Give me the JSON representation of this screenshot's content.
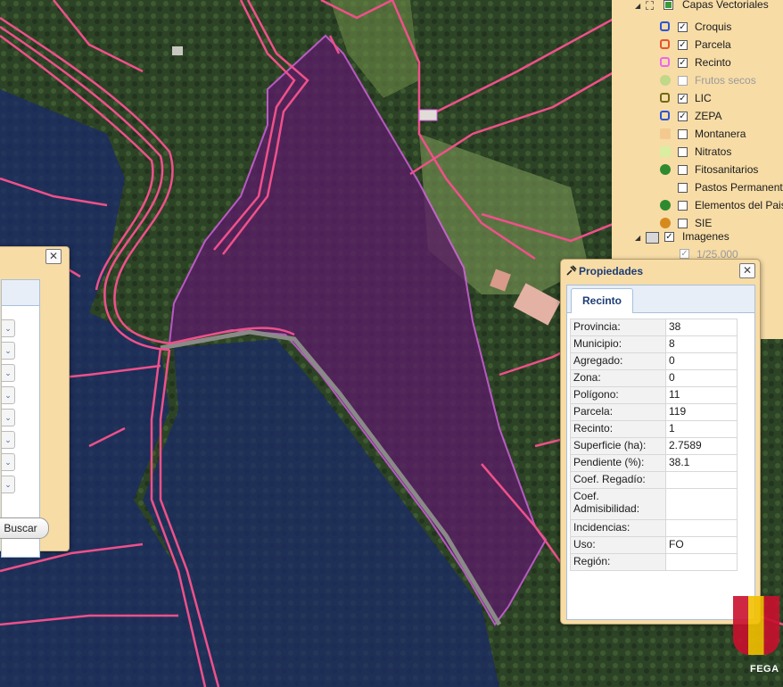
{
  "layers_panel": {
    "group_label": "Capas Vectoriales",
    "items": [
      {
        "label": "Croquis",
        "checked": true,
        "swatch": "outline",
        "color": "#2c55d6",
        "disabled": false
      },
      {
        "label": "Parcela",
        "checked": true,
        "swatch": "outline",
        "color": "#e8542c",
        "disabled": false
      },
      {
        "label": "Recinto",
        "checked": true,
        "swatch": "outline",
        "color": "#ee66ee",
        "disabled": false
      },
      {
        "label": "Frutos secos",
        "checked": false,
        "swatch": "dots",
        "color": "#8ad46a",
        "disabled": true
      },
      {
        "label": "LIC",
        "checked": true,
        "swatch": "outline",
        "color": "#6f6a14",
        "disabled": false
      },
      {
        "label": "ZEPA",
        "checked": true,
        "swatch": "outline",
        "color": "#2c55d6",
        "disabled": false
      },
      {
        "label": "Montanera",
        "checked": false,
        "swatch": "fill",
        "color": "#f4c98f",
        "disabled": false
      },
      {
        "label": "Nitratos",
        "checked": false,
        "swatch": "fill",
        "color": "#d9eea0",
        "disabled": false
      },
      {
        "label": "Fitosanitarios",
        "checked": false,
        "swatch": "dots",
        "color": "#2f8a2f",
        "disabled": false
      },
      {
        "label": "Pastos Permanentes",
        "checked": false,
        "swatch": "none",
        "color": "",
        "disabled": false
      },
      {
        "label": "Elementos del Paisaje",
        "checked": false,
        "swatch": "dots",
        "color": "#2f8a2f",
        "disabled": false
      },
      {
        "label": "SIE",
        "checked": false,
        "swatch": "dots",
        "color": "#d68a1e",
        "disabled": false
      }
    ],
    "imagenes_label": "Imagenes",
    "imagenes_checked": true,
    "sub_label": "1/25.000"
  },
  "search_panel": {
    "close_label": "✕",
    "dropdown_count": 8,
    "button_label": "Buscar"
  },
  "properties_dialog": {
    "title": "Propiedades",
    "close_label": "✕",
    "tab": "Recinto",
    "rows": [
      {
        "key": "Provincia:",
        "value": "38"
      },
      {
        "key": "Municipio:",
        "value": "8"
      },
      {
        "key": "Agregado:",
        "value": "0"
      },
      {
        "key": "Zona:",
        "value": "0"
      },
      {
        "key": "Polígono:",
        "value": "11"
      },
      {
        "key": "Parcela:",
        "value": "119"
      },
      {
        "key": "Recinto:",
        "value": "1"
      },
      {
        "key": "Superficie (ha):",
        "value": "2.7589"
      },
      {
        "key": "Pendiente (%):",
        "value": "38.1"
      },
      {
        "key": "Coef. Regadío:",
        "value": ""
      },
      {
        "key": "Coef. Admisibilidad:",
        "value": ""
      },
      {
        "key": "Incidencias:",
        "value": ""
      },
      {
        "key": "Uso:",
        "value": "FO"
      },
      {
        "key": "Región:",
        "value": ""
      }
    ]
  },
  "logo": {
    "text": "FEGA"
  },
  "colors": {
    "parcel_line": "#f0508a",
    "recinto_fill": "#5a1c66",
    "recinto_line": "#e060f0",
    "zepa_fill": "#1a2a6a"
  }
}
